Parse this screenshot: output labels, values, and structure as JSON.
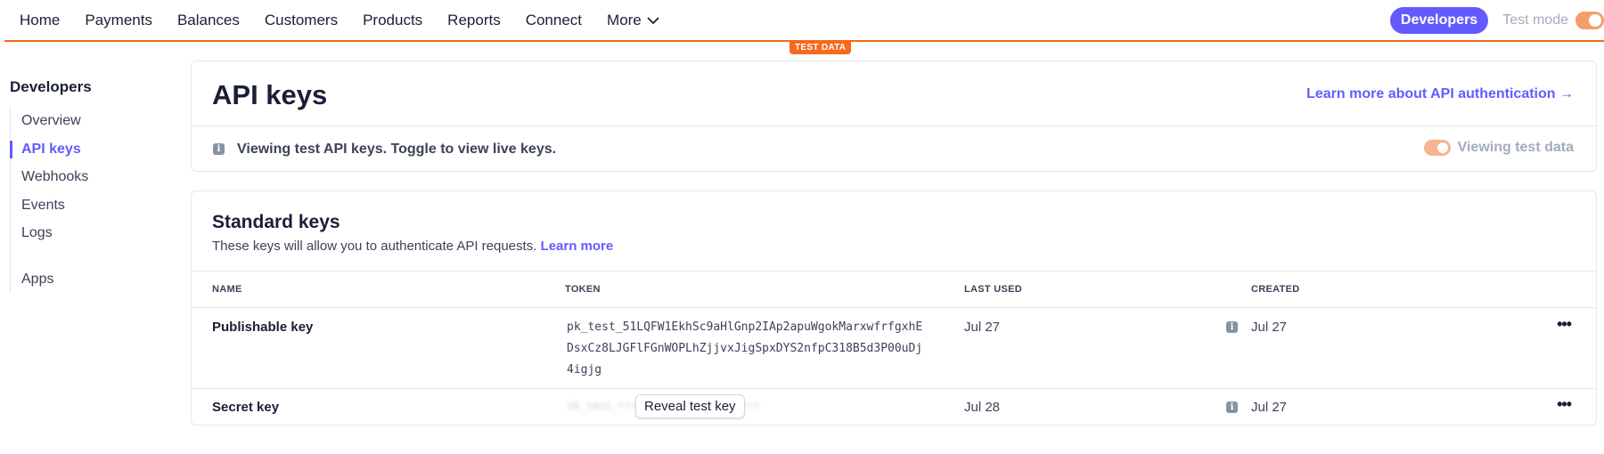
{
  "nav": {
    "items": [
      "Home",
      "Payments",
      "Balances",
      "Customers",
      "Products",
      "Reports",
      "Connect"
    ],
    "more_label": "More",
    "developers_label": "Developers",
    "test_mode_label": "Test mode",
    "test_data_badge": "TEST DATA"
  },
  "sidebar": {
    "title": "Developers",
    "items": [
      {
        "label": "Overview"
      },
      {
        "label": "API keys"
      },
      {
        "label": "Webhooks"
      },
      {
        "label": "Events"
      },
      {
        "label": "Logs"
      },
      {
        "label": "Apps"
      }
    ],
    "active": "API keys"
  },
  "header_card": {
    "title": "API keys",
    "learn_link": "Learn more about API authentication →",
    "info_text": "Viewing test API keys. Toggle to view live keys.",
    "toggle_label": "Viewing test data"
  },
  "standard_keys": {
    "title": "Standard keys",
    "subtitle": "These keys will allow you to authenticate API requests.",
    "subtitle_link": "Learn more",
    "columns": [
      "NAME",
      "TOKEN",
      "LAST USED",
      "CREATED"
    ],
    "rows": [
      {
        "name": "Publishable key",
        "token": "pk_test_51LQFW1EkhSc9aHlGnp2IAp2apuWgokMarxwfrfgxhEDsxCz8LJGFlFGnWOPLhZjjvxJigSpxDYS2nfpC318B5d3P00uDj4igjg",
        "last_used": "Jul 27",
        "created": "Jul 27"
      },
      {
        "name": "Secret key",
        "reveal_label": "Reveal test key",
        "last_used": "Jul 28",
        "created": "Jul 27"
      }
    ]
  },
  "colors": {
    "accent": "#635bff",
    "test_orange": "#f56a1c"
  }
}
